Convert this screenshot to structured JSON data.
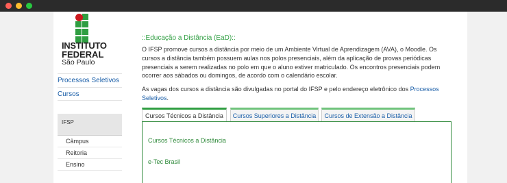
{
  "logo": {
    "line1": "INSTITUTO",
    "line2": "FEDERAL",
    "line3": "São Paulo",
    "green": "#2f9e41",
    "red": "#cd191e"
  },
  "sidebar": {
    "links": [
      "Processos Seletivos",
      "Cursos"
    ],
    "section": "IFSP",
    "sub_items": [
      "Câmpus",
      "Reitoria",
      "Ensino"
    ]
  },
  "main": {
    "title": "::Educação a Distância (EaD)::",
    "paragraph1": "O IFSP promove cursos a distância por meio de um Ambiente Virtual de Aprendizagem (AVA), o Moodle. Os cursos a distância também possuem aulas nos polos presenciais, além da aplicação de provas periódicas presenciais a serem realizadas no polo em que o aluno estiver matriculado. Os encontros presenciais podem ocorrer aos sábados ou domingos, de acordo com o calendário escolar.",
    "paragraph2_text": "As vagas dos cursos a distância são divulgadas no portal do IFSP e pelo endereço eletrônico dos ",
    "paragraph2_link": "Processos Seletivos",
    "paragraph2_end": ".",
    "tabs": [
      "Cursos Técnicos a Distância",
      "Cursos Superiores a Distância",
      "Cursos de Extensão a Distância"
    ],
    "active_tab": "Cursos Técnicos a Distância",
    "panel_items": [
      "Cursos Técnicos a Distância",
      "e-Tec Brasil"
    ]
  }
}
